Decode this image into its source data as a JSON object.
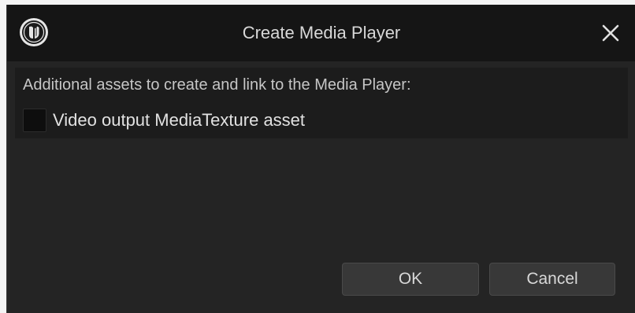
{
  "window": {
    "title": "Create Media Player",
    "logo_icon": "unreal-engine-logo-icon",
    "close_icon": "close-icon"
  },
  "content": {
    "description": "Additional assets to create and link to the Media Player:",
    "checkbox": {
      "label": "Video output MediaTexture asset",
      "checked": false
    }
  },
  "buttons": {
    "ok_label": "OK",
    "cancel_label": "Cancel"
  },
  "colors": {
    "titlebar_bg": "#151515",
    "dialog_bg": "#242424",
    "panel_bg": "#1c1c1c",
    "button_bg": "#383838"
  }
}
